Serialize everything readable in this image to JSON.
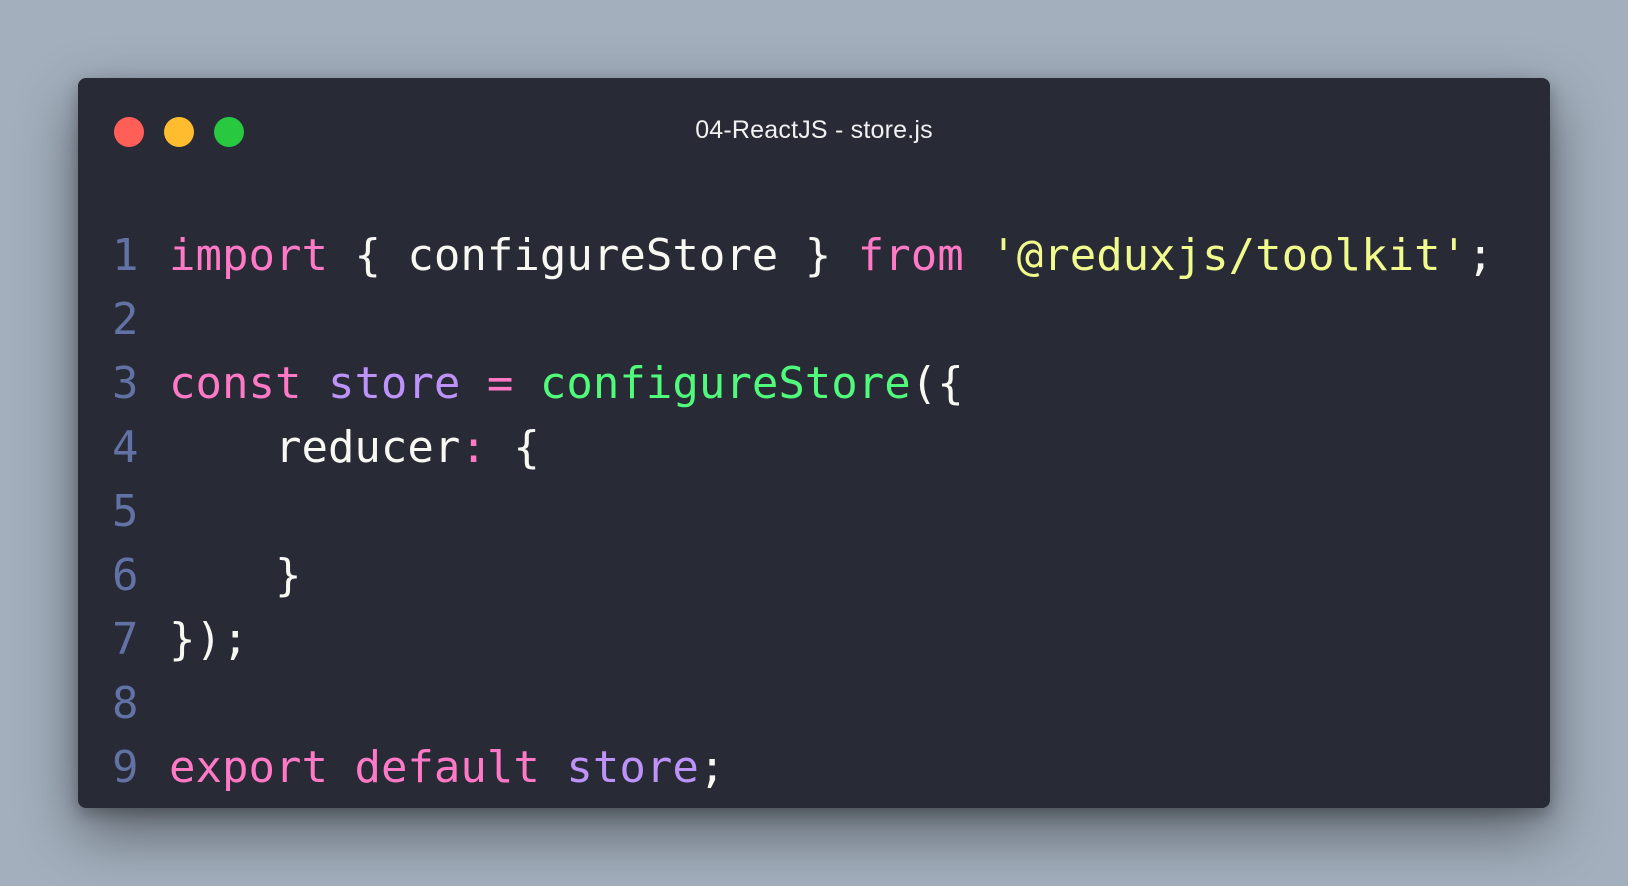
{
  "window": {
    "title": "04-ReactJS - store.js",
    "controls": {
      "close": {
        "icon": "close-dot-icon",
        "color": "#ff5f57"
      },
      "minimize": {
        "icon": "minimize-dot-icon",
        "color": "#febc2e"
      },
      "maximize": {
        "icon": "maximize-dot-icon",
        "color": "#28c840"
      }
    }
  },
  "code": {
    "lines": [
      {
        "number": "1",
        "tokens": [
          {
            "text": "import",
            "type": "keyword"
          },
          {
            "text": " { configureStore } ",
            "type": "plain"
          },
          {
            "text": "from",
            "type": "keyword"
          },
          {
            "text": " ",
            "type": "plain"
          },
          {
            "text": "'@reduxjs/toolkit'",
            "type": "string"
          },
          {
            "text": ";",
            "type": "punct"
          }
        ]
      },
      {
        "number": "2",
        "tokens": []
      },
      {
        "number": "3",
        "tokens": [
          {
            "text": "const",
            "type": "keyword"
          },
          {
            "text": " ",
            "type": "plain"
          },
          {
            "text": "store",
            "type": "var"
          },
          {
            "text": " ",
            "type": "plain"
          },
          {
            "text": "=",
            "type": "op"
          },
          {
            "text": " ",
            "type": "plain"
          },
          {
            "text": "configureStore",
            "type": "func"
          },
          {
            "text": "({",
            "type": "punct"
          }
        ]
      },
      {
        "number": "4",
        "tokens": [
          {
            "text": "    reducer",
            "type": "plain"
          },
          {
            "text": ":",
            "type": "op"
          },
          {
            "text": " {",
            "type": "punct"
          }
        ]
      },
      {
        "number": "5",
        "tokens": []
      },
      {
        "number": "6",
        "tokens": [
          {
            "text": "    }",
            "type": "punct"
          }
        ]
      },
      {
        "number": "7",
        "tokens": [
          {
            "text": "});",
            "type": "punct"
          }
        ]
      },
      {
        "number": "8",
        "tokens": []
      },
      {
        "number": "9",
        "tokens": [
          {
            "text": "export",
            "type": "keyword"
          },
          {
            "text": " ",
            "type": "plain"
          },
          {
            "text": "default",
            "type": "keyword"
          },
          {
            "text": " ",
            "type": "plain"
          },
          {
            "text": "store",
            "type": "var"
          },
          {
            "text": ";",
            "type": "punct"
          }
        ]
      }
    ]
  }
}
